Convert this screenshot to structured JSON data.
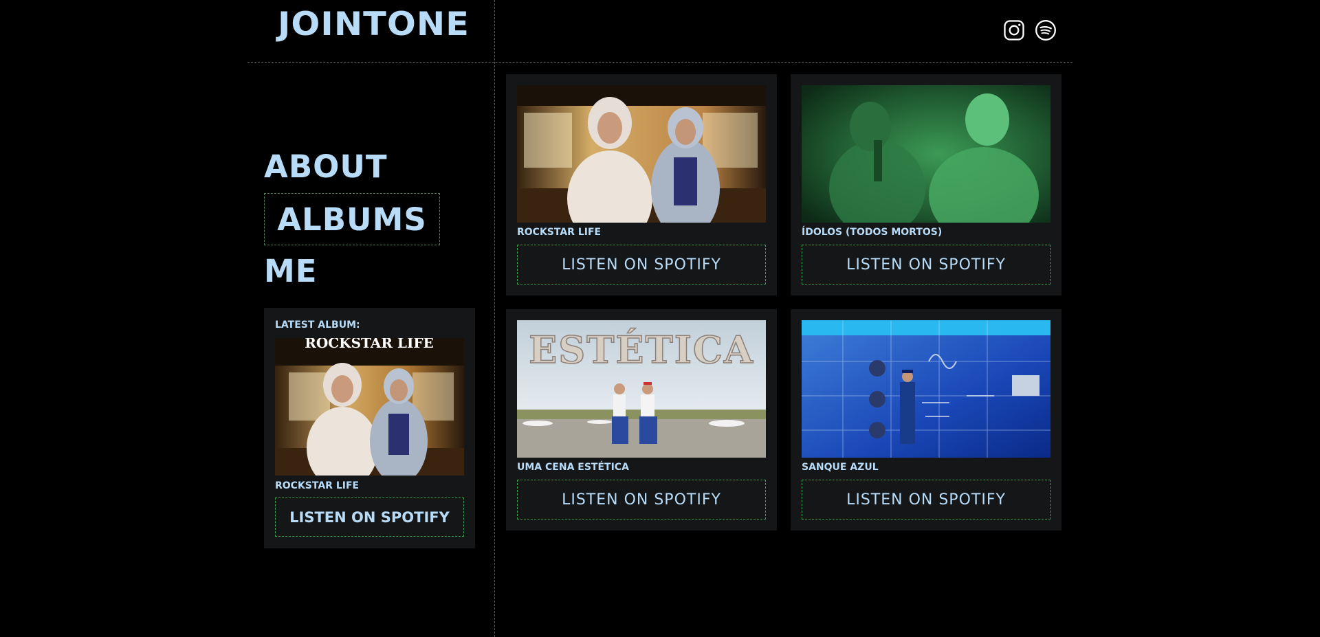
{
  "header": {
    "logo": "JOINTONE",
    "social": [
      {
        "icon": "instagram-icon"
      },
      {
        "icon": "spotify-icon"
      }
    ]
  },
  "nav": {
    "items": [
      {
        "label": "ABOUT"
      },
      {
        "label": "ALBUMS",
        "active": true
      },
      {
        "label": "ME"
      }
    ]
  },
  "latest": {
    "label": "LATEST ALBUM:",
    "title": "ROCKSTAR LIFE",
    "button": "LISTEN ON SPOTIFY",
    "cover_text": "ROCKSTAR LIFE"
  },
  "albums": [
    {
      "title": "ROCKSTAR LIFE",
      "button": "LISTEN ON SPOTIFY"
    },
    {
      "title": "ÍDOLOS (TODOS MORTOS)",
      "button": "LISTEN ON SPOTIFY"
    },
    {
      "title": "UMA CENA ESTÉTICA",
      "button": "LISTEN ON SPOTIFY",
      "cover_text": "ESTÉTICA"
    },
    {
      "title": "SANQUE AZUL",
      "button": "LISTEN ON SPOTIFY"
    }
  ],
  "colors": {
    "background": "#000000",
    "card": "#141618",
    "accent_text": "#b8dcf8",
    "button_border": "#3aa655"
  }
}
